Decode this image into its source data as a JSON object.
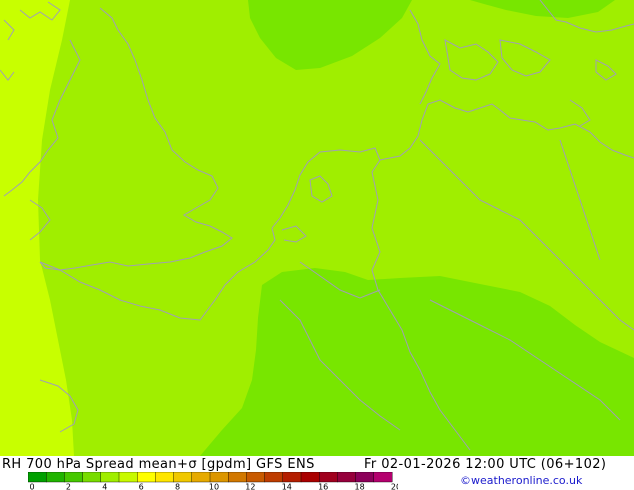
{
  "footer": {
    "title": "RH 700 hPa Spread mean+σ [gpdm] GFS ENS",
    "datetime": "Fr 02-01-2026 12:00 UTC (06+102)",
    "credit": "©weatheronline.co.uk"
  },
  "legend": {
    "ticks": [
      "0",
      "2",
      "4",
      "6",
      "8",
      "10",
      "12",
      "14",
      "16",
      "18",
      "20"
    ],
    "colors": [
      "#00a000",
      "#20b400",
      "#46c800",
      "#78dc00",
      "#a0ee00",
      "#c8fa00",
      "#ffff00",
      "#ffe600",
      "#f0c800",
      "#e6aa00",
      "#dc9600",
      "#d27800",
      "#c85a00",
      "#be3c00",
      "#b41e00",
      "#aa0000",
      "#a0001e",
      "#96003c",
      "#8c005a",
      "#b4006e"
    ]
  },
  "map": {
    "fill_colors": {
      "yellow_green": "#c8ff00",
      "light_green": "#a0ee00",
      "mid_green": "#78e600"
    },
    "coastline_color": "#a0a0b4",
    "region": "North Sea, British Isles, Benelux, Northern Germany, Denmark"
  }
}
